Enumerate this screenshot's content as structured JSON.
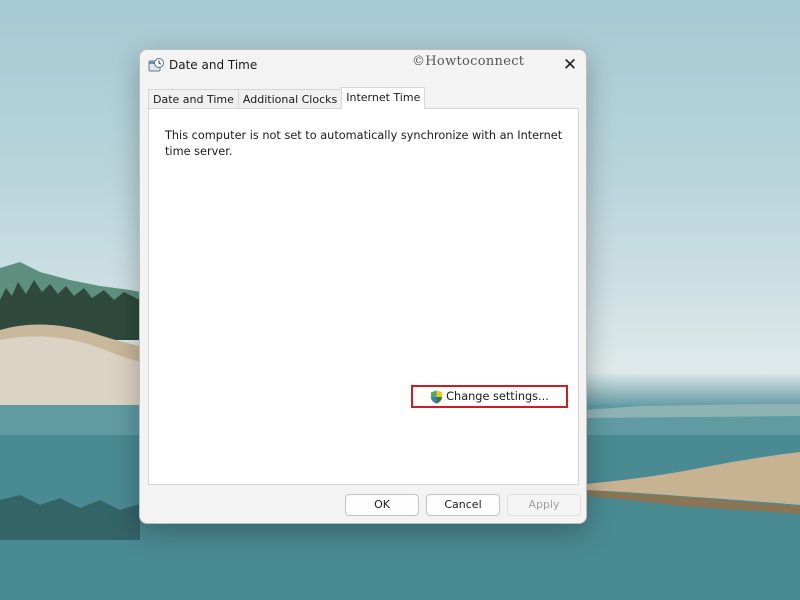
{
  "window": {
    "title": "Date and Time",
    "watermark": "©Howtoconnect",
    "close_icon": "close-icon",
    "close_glyph": "✕"
  },
  "tabs": [
    {
      "label": "Date and Time",
      "active": false
    },
    {
      "label": "Additional Clocks",
      "active": false
    },
    {
      "label": "Internet Time",
      "active": true
    }
  ],
  "internet_time": {
    "status_text": "This computer is not set to automatically synchronize with an Internet time server.",
    "change_settings_label": "Change settings...",
    "change_settings_icon": "uac-shield-icon",
    "highlight_color": "#cc1f1f"
  },
  "footer": {
    "ok_label": "OK",
    "cancel_label": "Cancel",
    "apply_label": "Apply",
    "apply_enabled": false
  }
}
